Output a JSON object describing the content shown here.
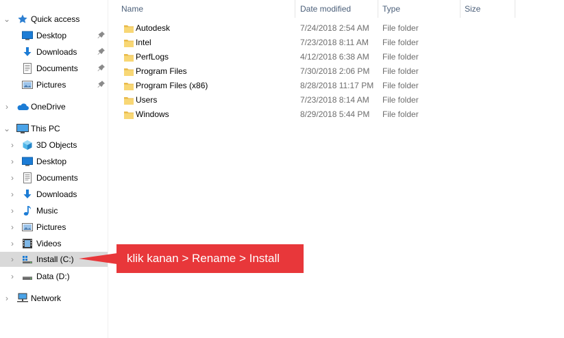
{
  "nav": {
    "quick_access": {
      "label": "Quick access",
      "items": [
        {
          "label": "Desktop",
          "icon": "desktop-icon",
          "pinned": true
        },
        {
          "label": "Downloads",
          "icon": "downloads-icon",
          "pinned": true
        },
        {
          "label": "Documents",
          "icon": "documents-icon",
          "pinned": true
        },
        {
          "label": "Pictures",
          "icon": "pictures-icon",
          "pinned": true
        }
      ]
    },
    "onedrive": {
      "label": "OneDrive",
      "icon": "onedrive-icon"
    },
    "this_pc": {
      "label": "This PC",
      "items": [
        {
          "label": "3D Objects",
          "icon": "3d-objects-icon"
        },
        {
          "label": "Desktop",
          "icon": "desktop-icon"
        },
        {
          "label": "Documents",
          "icon": "documents-icon"
        },
        {
          "label": "Downloads",
          "icon": "downloads-icon"
        },
        {
          "label": "Music",
          "icon": "music-icon"
        },
        {
          "label": "Pictures",
          "icon": "pictures-icon"
        },
        {
          "label": "Videos",
          "icon": "videos-icon"
        },
        {
          "label": "Install (C:)",
          "icon": "drive-c-icon",
          "selected": true
        },
        {
          "label": "Data (D:)",
          "icon": "drive-d-icon"
        }
      ]
    },
    "network": {
      "label": "Network",
      "icon": "network-icon"
    }
  },
  "columns": {
    "name": "Name",
    "date_modified": "Date modified",
    "type": "Type",
    "size": "Size"
  },
  "files": [
    {
      "name": "Autodesk",
      "date": "7/24/2018 2:54 AM",
      "type": "File folder"
    },
    {
      "name": "Intel",
      "date": "7/23/2018 8:11 AM",
      "type": "File folder"
    },
    {
      "name": "PerfLogs",
      "date": "4/12/2018 6:38 AM",
      "type": "File folder"
    },
    {
      "name": "Program Files",
      "date": "7/30/2018 2:06 PM",
      "type": "File folder"
    },
    {
      "name": "Program Files (x86)",
      "date": "8/28/2018 11:17 PM",
      "type": "File folder"
    },
    {
      "name": "Users",
      "date": "7/23/2018 8:14 AM",
      "type": "File folder"
    },
    {
      "name": "Windows",
      "date": "8/29/2018 5:44 PM",
      "type": "File folder"
    }
  ],
  "callout": {
    "text": "klik kanan > Rename > Install",
    "color": "#e8373a"
  },
  "colors": {
    "header_text": "#4c607a",
    "selected_row": "#d9d9d9",
    "folder_yellow": "#f8d775"
  }
}
